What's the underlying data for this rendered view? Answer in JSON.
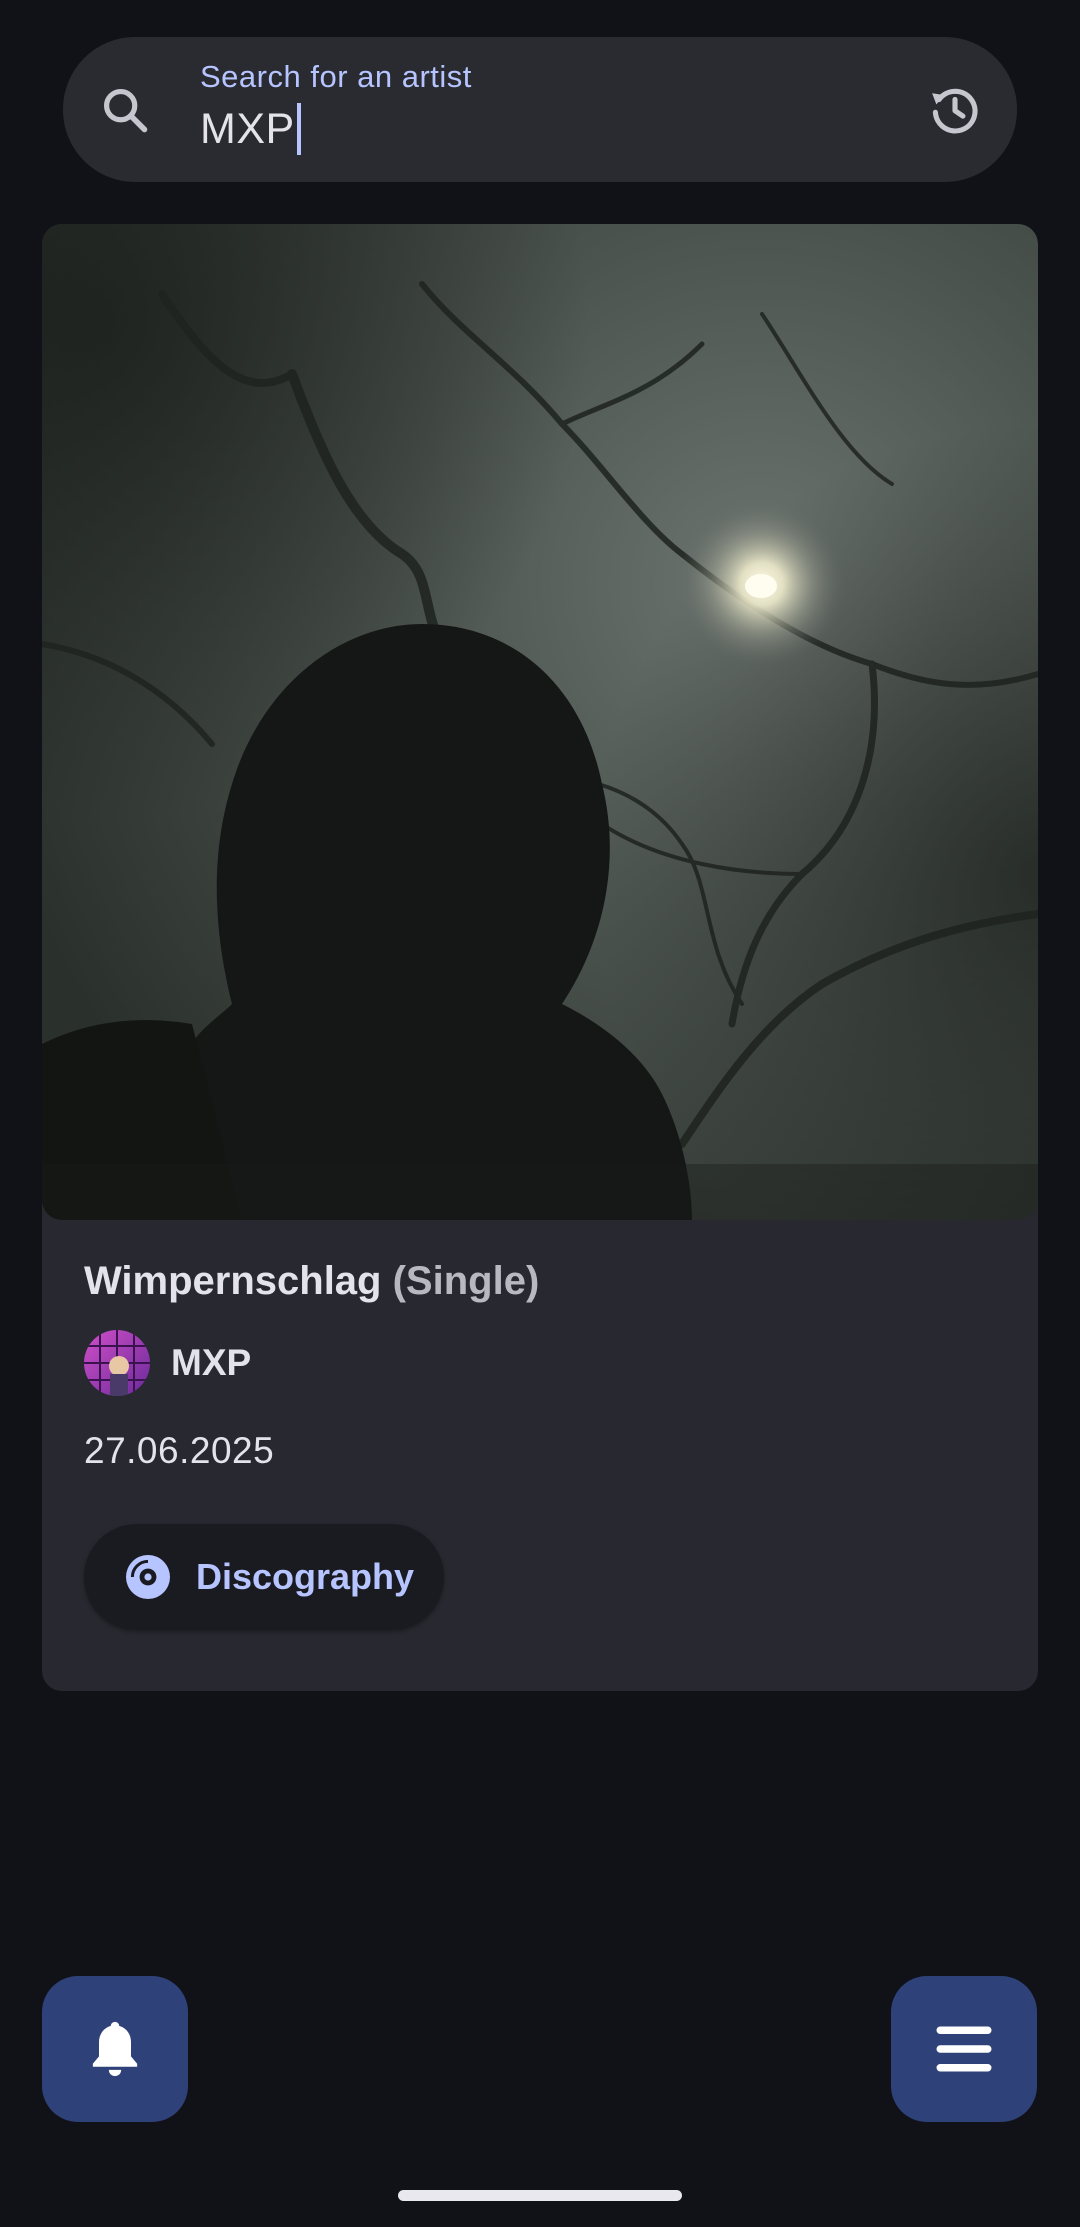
{
  "search": {
    "label": "Search for an artist",
    "value": "MXP"
  },
  "release": {
    "title": "Wimpernschlag",
    "type": "(Single)",
    "artist": "MXP",
    "date": "27.06.2025",
    "discography_label": "Discography"
  },
  "icons": {
    "search": "search-icon",
    "history": "history-icon",
    "disc": "disc-icon",
    "bell": "bell-icon",
    "menu": "menu-icon"
  },
  "colors": {
    "background": "#111218",
    "surface": "#282930",
    "accent": "#b6c4ff",
    "fab": "#2f4179"
  }
}
